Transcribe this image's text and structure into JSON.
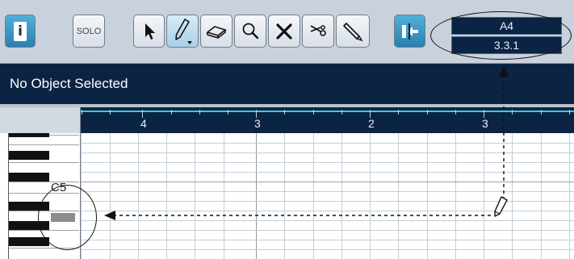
{
  "toolbar": {
    "buttons": [
      {
        "name": "info-button",
        "icon": "info-icon",
        "glyph": "i"
      },
      {
        "name": "solo-button",
        "label": "SOLO"
      },
      {
        "name": "object-selection-tool",
        "icon": "arrow-pointer-icon"
      },
      {
        "name": "draw-tool",
        "icon": "pencil-icon",
        "selected": true
      },
      {
        "name": "erase-tool",
        "icon": "eraser-icon"
      },
      {
        "name": "zoom-tool",
        "icon": "magnifier-icon"
      },
      {
        "name": "mute-tool",
        "icon": "x-cross-icon"
      },
      {
        "name": "split-tool",
        "icon": "scissors-icon"
      },
      {
        "name": "glue-tool",
        "icon": "glue-tube-icon"
      },
      {
        "name": "autoscroll-button",
        "icon": "autoscroll-icon"
      }
    ],
    "pitch_readout": "A4",
    "position_readout": "3.3.1"
  },
  "info_line": {
    "text": "No Object Selected"
  },
  "ruler": {
    "numbers": [
      "4",
      "3",
      "2",
      "3"
    ]
  },
  "keyboard": {
    "label": "C5"
  },
  "cursor": {
    "icon": "pencil-cursor-icon"
  },
  "colors": {
    "toolbar_bg": "#c9d2dc",
    "dark_panel": "#0c2444",
    "ruler_accent": "#2fd0d8",
    "blue_button": "#2b7fb1"
  }
}
